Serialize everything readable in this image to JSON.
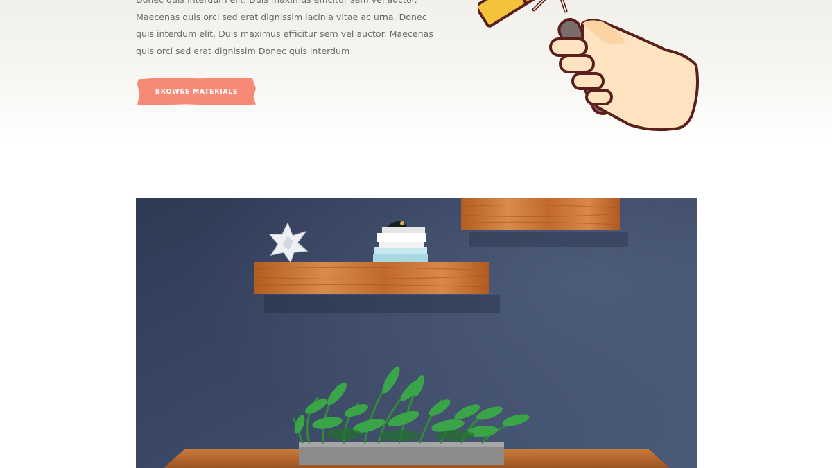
{
  "hero": {
    "paragraph_lines": [
      "Donec quis interdum elit. Duis maximus efficitur sem vel auctor.",
      "Maecenas quis orci sed erat dignissim lacinia vitae ac urna. Donec",
      "quis interdum elit. Duis maximus efficitur sem vel auctor. Maecenas",
      "quis orci sed erat dignissim Donec quis interdum"
    ],
    "cta_label": "BROWSE MATERIALS"
  },
  "illustration": {
    "icon": "hand-holding-paint-roller-icon"
  },
  "photo": {
    "subject": "blue-wall-with-wooden-shelves-and-plant-image"
  },
  "colors": {
    "cta": "#f68a76",
    "wall": "#3b4865",
    "wood": "#c06a2c",
    "hand_skin": "#fde3c0",
    "outline": "#5a1f1a",
    "roller": "#f5c33b"
  }
}
